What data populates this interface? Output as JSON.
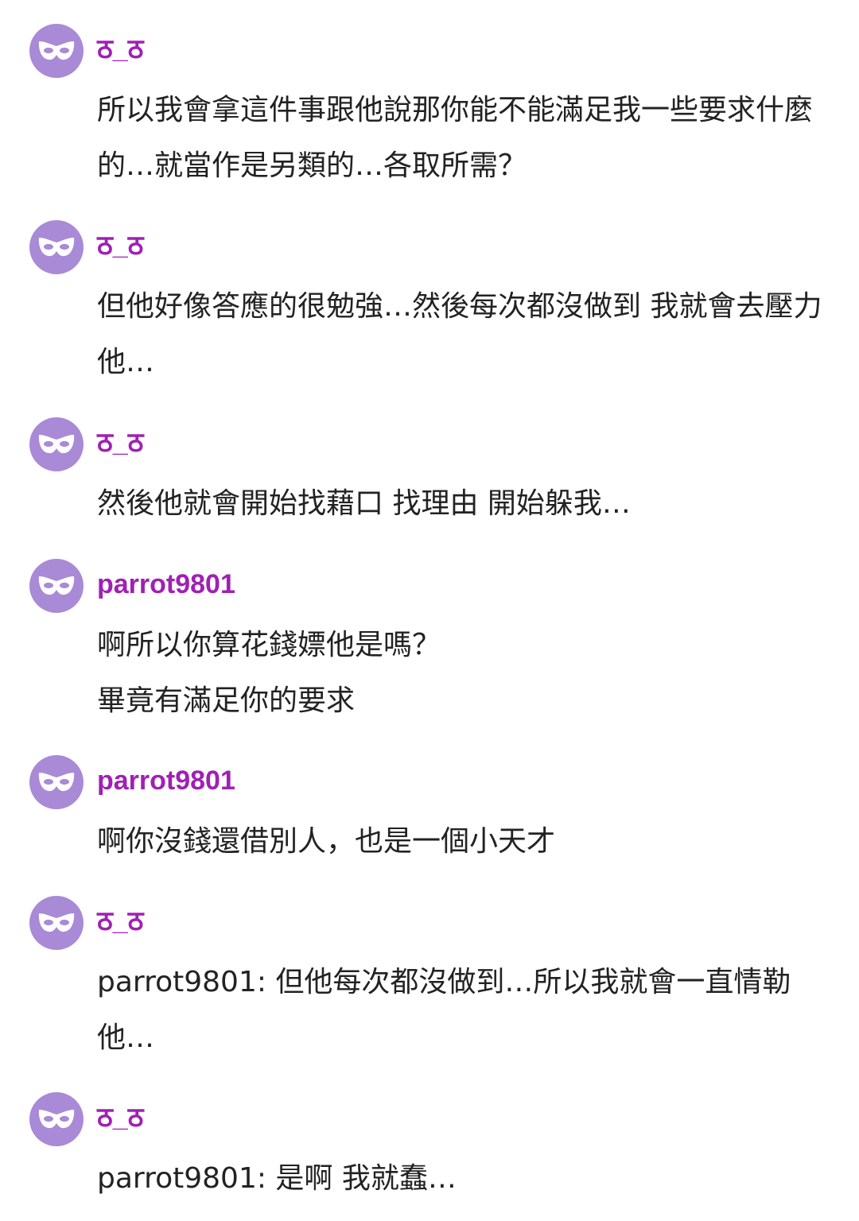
{
  "colors": {
    "username": "#a020b4",
    "avatar_bg": "#a98ad6",
    "text": "#222222",
    "background": "#ffffff"
  },
  "messages": [
    {
      "username": "ठ_ठ",
      "avatar_icon": "mask-icon",
      "text": "所以我會拿這件事跟他說那你能不能滿足我一些要求什麼的…就當作是另類的…各取所需？"
    },
    {
      "username": "ठ_ठ",
      "avatar_icon": "mask-icon",
      "text": "但他好像答應的很勉強…然後每次都沒做到 我就會去壓力他…"
    },
    {
      "username": "ठ_ठ",
      "avatar_icon": "mask-icon",
      "text": "然後他就會開始找藉口 找理由 開始躲我…"
    },
    {
      "username": "parrot9801",
      "avatar_icon": "mask-icon",
      "text": "啊所以你算花錢嫖他是嗎？\n畢竟有滿足你的要求"
    },
    {
      "username": "parrot9801",
      "avatar_icon": "mask-icon",
      "text": "啊你沒錢還借別人，也是一個小天才"
    },
    {
      "username": "ठ_ठ",
      "avatar_icon": "mask-icon",
      "text": "parrot9801: 但他每次都沒做到…所以我就會一直情勒他…"
    },
    {
      "username": "ठ_ठ",
      "avatar_icon": "mask-icon",
      "text": "parrot9801: 是啊 我就蠢…"
    }
  ]
}
